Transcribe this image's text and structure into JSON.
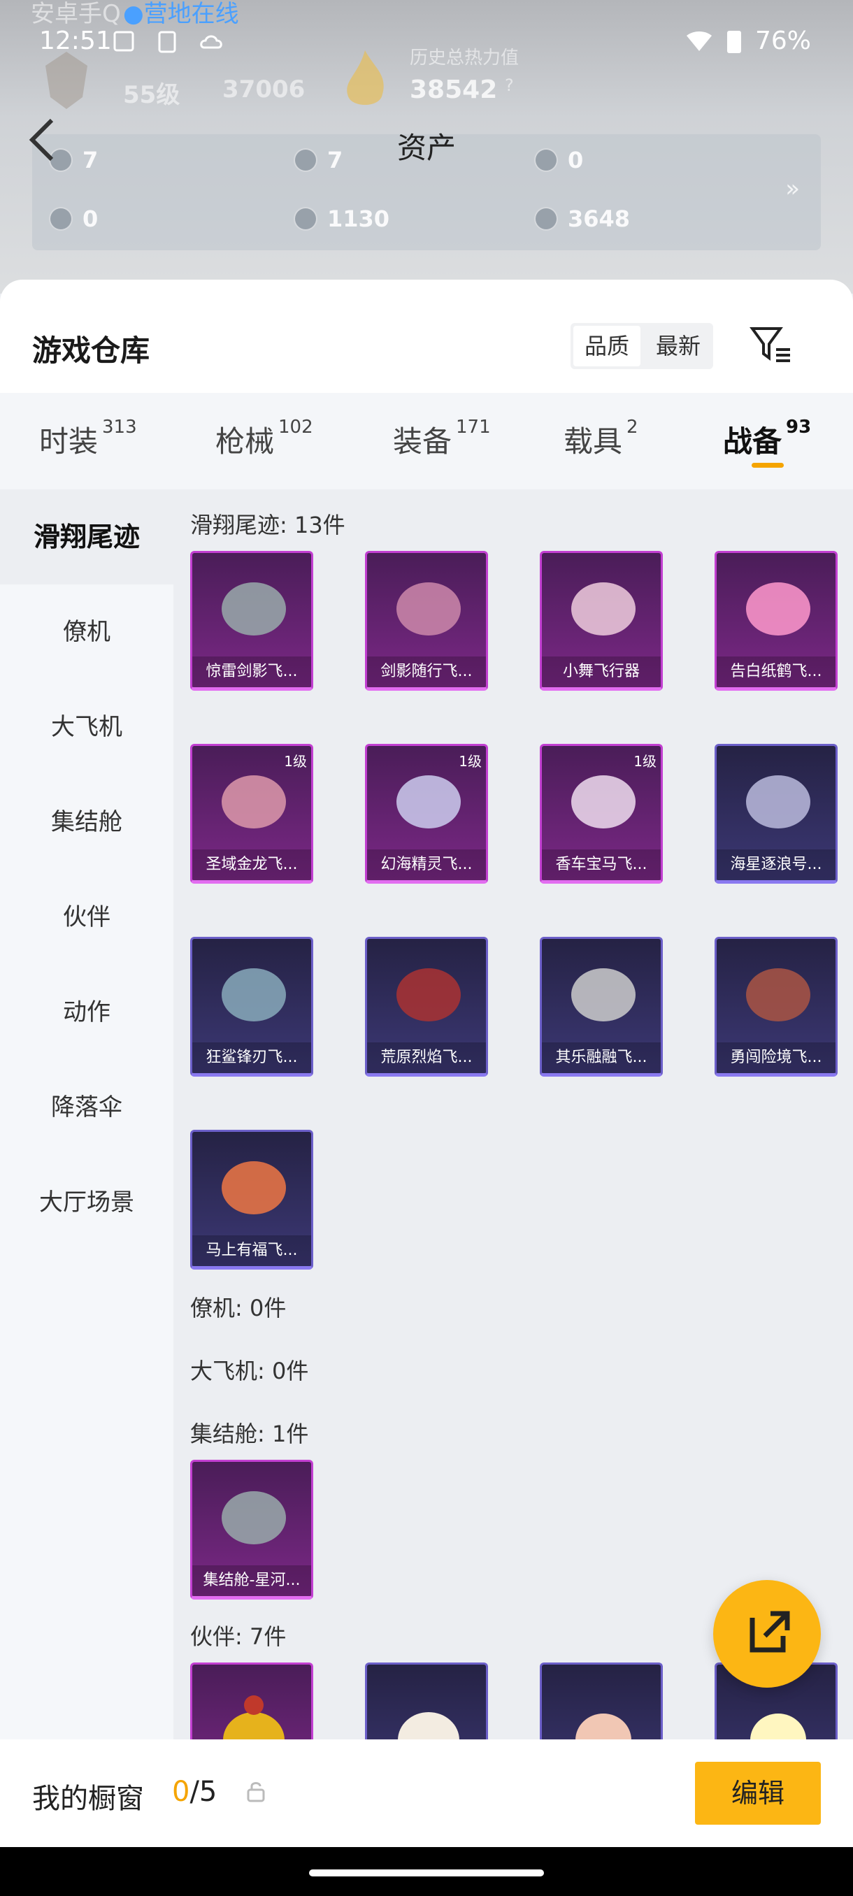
{
  "status_bar": {
    "time": "12:51",
    "battery": "76%"
  },
  "background": {
    "line1": "安卓手Q",
    "online": "●营地在线",
    "level": "55级",
    "points": "37006",
    "history_label": "历史总热力值",
    "history_value": "38542",
    "help": "?"
  },
  "header": {
    "title": "资产"
  },
  "assets": [
    {
      "icon": "card-icon",
      "value": "7"
    },
    {
      "icon": "s-coin-icon",
      "value": "7"
    },
    {
      "icon": "a-coin-icon",
      "value": "0"
    },
    {
      "icon": "ticket-icon",
      "value": "0"
    },
    {
      "icon": "silver-coin-icon",
      "value": "1130"
    },
    {
      "icon": "bronze-coin-icon",
      "value": "3648"
    }
  ],
  "warehouse": {
    "title": "游戏仓库",
    "sort": [
      "品质",
      "最新"
    ]
  },
  "tabs": [
    {
      "label": "时装",
      "count": "313"
    },
    {
      "label": "枪械",
      "count": "102"
    },
    {
      "label": "装备",
      "count": "171"
    },
    {
      "label": "载具",
      "count": "2"
    },
    {
      "label": "战备",
      "count": "93"
    }
  ],
  "sidebar": [
    "滑翔尾迹",
    "僚机",
    "大飞机",
    "集结舱",
    "伙伴",
    "动作",
    "降落伞",
    "大厅场景"
  ],
  "sections": {
    "glide": {
      "title": "滑翔尾迹: 13件",
      "items": [
        {
          "name": "惊雷剑影飞...",
          "tier": "purple",
          "level": ""
        },
        {
          "name": "剑影随行飞...",
          "tier": "purple",
          "level": ""
        },
        {
          "name": "小舞飞行器",
          "tier": "purple",
          "level": ""
        },
        {
          "name": "告白纸鹤飞...",
          "tier": "purple",
          "level": ""
        },
        {
          "name": "圣域金龙飞...",
          "tier": "purple",
          "level": "1级"
        },
        {
          "name": "幻海精灵飞...",
          "tier": "purple",
          "level": "1级"
        },
        {
          "name": "香车宝马飞...",
          "tier": "purple",
          "level": "1级"
        },
        {
          "name": "海星逐浪号...",
          "tier": "blue",
          "level": ""
        },
        {
          "name": "狂鲨锋刃飞...",
          "tier": "blue",
          "level": ""
        },
        {
          "name": "荒原烈焰飞...",
          "tier": "blue",
          "level": ""
        },
        {
          "name": "其乐融融飞...",
          "tier": "blue",
          "level": ""
        },
        {
          "name": "勇闯险境飞...",
          "tier": "blue",
          "level": ""
        },
        {
          "name": "马上有福飞...",
          "tier": "blue",
          "level": ""
        }
      ]
    },
    "wingman": {
      "title": "僚机: 0件"
    },
    "plane": {
      "title": "大飞机: 0件"
    },
    "pod": {
      "title": "集结舱: 1件",
      "items": [
        {
          "name": "集结舱-星河...",
          "tier": "purple",
          "level": ""
        }
      ]
    },
    "partner": {
      "title": "伙伴: 7件"
    }
  },
  "showcase": {
    "label": "我的橱窗",
    "current": "0",
    "total": "/5",
    "edit": "编辑"
  },
  "colors": {
    "accent": "#fcb614",
    "purple_border": "#c23fd1",
    "blue_border": "#6c5fc9"
  }
}
